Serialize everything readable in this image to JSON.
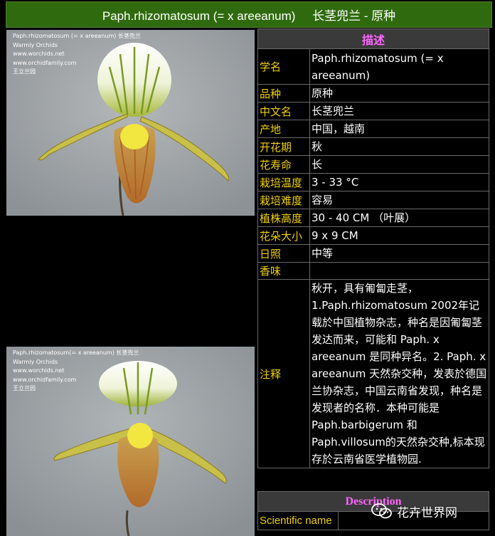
{
  "title": "Paph.rhizomatosum (= x areeanum)     长茎兜兰 - 原种",
  "photo1": {
    "watermark": [
      "Paph.rhizomatosum (= x areeanum) 长茎兜兰",
      "Warmly  Orchids",
      "www.worchids.net",
      "www.orchidfamily.com",
      "王立兰园"
    ]
  },
  "photo2": {
    "watermark": [
      "Paph.rhizomatosum(= x areeanum) 长茎兜兰",
      "Warmly Orchids",
      "www.worchids.net",
      "www.orchidfamily.com",
      "王立兰园"
    ]
  },
  "description": {
    "header": "描述",
    "rows": [
      {
        "key": "学名",
        "value": "Paph.rhizomatosum (= x areeanum)"
      },
      {
        "key": "品种",
        "value": "原种"
      },
      {
        "key": "中文名",
        "value": "长茎兜兰"
      },
      {
        "key": "产地",
        "value": "中国，越南"
      },
      {
        "key": "开花期",
        "value": "秋"
      },
      {
        "key": "花寿命",
        "value": "长"
      },
      {
        "key": "栽培温度",
        "value": "3 - 33 °C"
      },
      {
        "key": "栽培难度",
        "value": "容易"
      },
      {
        "key": "植株高度",
        "value": "30 - 40 CM （叶展）"
      },
      {
        "key": "花朵大小",
        "value": "9 x 9 CM"
      },
      {
        "key": "日照",
        "value": "中等"
      },
      {
        "key": "香味",
        "value": ""
      },
      {
        "key": "注释",
        "value": "秋开，具有匍匐走茎，1.Paph.rhizomatosum 2002年记载於中国植物杂志，种名是因匍匐茎发达而来，可能和 Paph. x areeanum 是同种异名。2. Paph. x areeanum 天然杂交种，发表於德国兰协杂志，中国云南省发现，种名是发现者的名称．本种可能是Paph.barbigerum 和 Paph.villosum的天然杂交种,标本现存於云南省医学植物园."
      }
    ]
  },
  "description_en": {
    "header": "Description",
    "rows": [
      {
        "key": "Scientific name",
        "value": ""
      }
    ]
  },
  "badge": {
    "text": "花卉世界网",
    "icon": "wechat-icon"
  }
}
